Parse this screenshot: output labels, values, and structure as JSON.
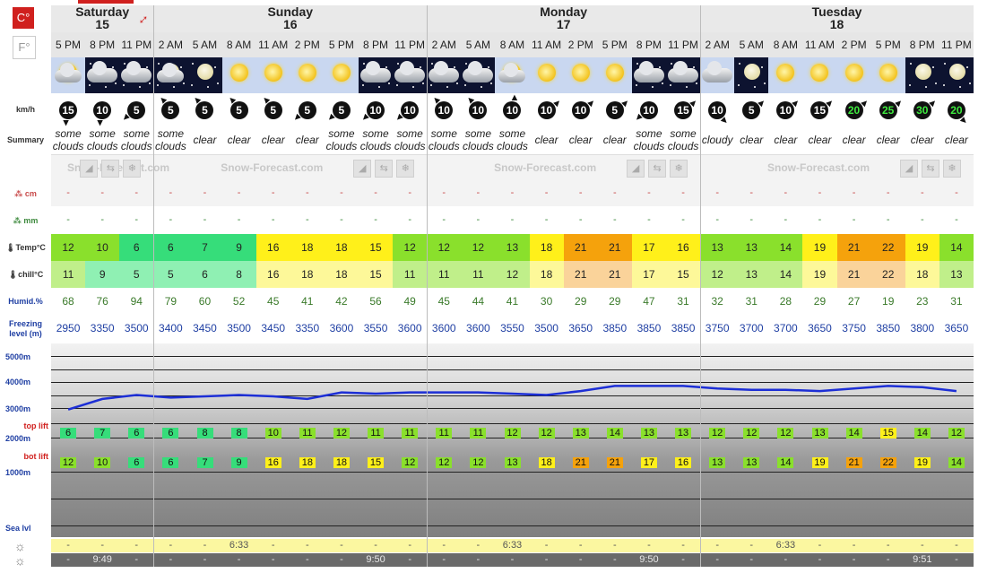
{
  "units": {
    "celsius": "C°",
    "fahrenheit": "F°"
  },
  "row_labels": {
    "wind": "km/h",
    "summary": "Summary",
    "snow": "cm",
    "rain": "mm",
    "temp": "Temp°C",
    "chill": "chill°C",
    "humid": "Humid.%",
    "freezing": "Freezing level (m)",
    "lift_top": "top lift",
    "lift_bot": "bot lift",
    "alt_5000": "5000m",
    "alt_4000": "4000m",
    "alt_3000": "3000m",
    "alt_2000": "2000m",
    "alt_1000": "1000m",
    "sea": "Sea lvl"
  },
  "days": [
    {
      "name": "Saturday",
      "date": "15",
      "cols": 3
    },
    {
      "name": "Sunday",
      "date": "16",
      "cols": 8
    },
    {
      "name": "Monday",
      "date": "17",
      "cols": 8
    },
    {
      "name": "Tuesday",
      "date": "18",
      "cols": 8
    }
  ],
  "logo_text": "Snow-Forecast.com",
  "hours": [
    "5 PM",
    "8 PM",
    "11 PM",
    "2 AM",
    "5 AM",
    "8 AM",
    "11 AM",
    "2 PM",
    "5 PM",
    "8 PM",
    "11 PM",
    "2 AM",
    "5 AM",
    "8 AM",
    "11 AM",
    "2 PM",
    "5 PM",
    "8 PM",
    "11 PM",
    "2 AM",
    "5 AM",
    "8 AM",
    "11 AM",
    "2 PM",
    "5 PM",
    "8 PM",
    "11 PM"
  ],
  "weather_icons": [
    "cloud-sun",
    "cloud-night",
    "cloud-night",
    "cloud-moon",
    "moon",
    "sun",
    "sun",
    "sun",
    "sun",
    "cloud-night",
    "cloud-night",
    "cloud-night",
    "cloud-night",
    "cloud-sun",
    "sun",
    "sun",
    "sun",
    "cloud-night",
    "cloud-night",
    "cloud",
    "moon",
    "sun",
    "sun",
    "sun",
    "sun",
    "moon",
    "moon"
  ],
  "wind_speed": [
    15,
    10,
    5,
    5,
    5,
    5,
    5,
    5,
    5,
    10,
    10,
    10,
    10,
    10,
    10,
    10,
    5,
    10,
    15,
    10,
    5,
    10,
    15,
    20,
    25,
    30,
    20
  ],
  "wind_arrow": [
    "down",
    "down",
    "down-left",
    "up-left",
    "up-left",
    "up-left",
    "up-left",
    "down-left",
    "down-left",
    "down-left",
    "down-left",
    "up-left",
    "up-left",
    "up",
    "up-right",
    "up-right",
    "up-right",
    "down-left",
    "up-right",
    "down-right",
    "up-right",
    "up-right",
    "up-right",
    "up-right",
    "up-right",
    "up-right",
    "down-right"
  ],
  "summary": [
    "some clouds",
    "some clouds",
    "some clouds",
    "some clouds",
    "clear",
    "clear",
    "clear",
    "clear",
    "some clouds",
    "some clouds",
    "some clouds",
    "some clouds",
    "some clouds",
    "some clouds",
    "clear",
    "clear",
    "clear",
    "some clouds",
    "some clouds",
    "cloudy",
    "clear",
    "clear",
    "clear",
    "clear",
    "clear",
    "clear",
    "clear"
  ],
  "snow": [
    "-",
    "-",
    "-",
    "-",
    "-",
    "-",
    "-",
    "-",
    "-",
    "-",
    "-",
    "-",
    "-",
    "-",
    "-",
    "-",
    "-",
    "-",
    "-",
    "-",
    "-",
    "-",
    "-",
    "-",
    "-",
    "-",
    "-"
  ],
  "rain": [
    "-",
    "-",
    "-",
    "-",
    "-",
    "-",
    "-",
    "-",
    "-",
    "-",
    "-",
    "-",
    "-",
    "-",
    "-",
    "-",
    "-",
    "-",
    "-",
    "-",
    "-",
    "-",
    "-",
    "-",
    "-",
    "-",
    "-"
  ],
  "temp": [
    12,
    10,
    6,
    6,
    7,
    9,
    16,
    18,
    18,
    15,
    12,
    12,
    12,
    13,
    18,
    21,
    21,
    17,
    16,
    13,
    13,
    14,
    19,
    21,
    22,
    19,
    14
  ],
  "chill": [
    11,
    9,
    5,
    5,
    6,
    8,
    16,
    18,
    18,
    15,
    11,
    11,
    11,
    12,
    18,
    21,
    21,
    17,
    15,
    12,
    13,
    14,
    19,
    21,
    22,
    18,
    13
  ],
  "humidity": [
    68,
    76,
    94,
    79,
    60,
    52,
    45,
    41,
    42,
    56,
    49,
    45,
    44,
    41,
    30,
    29,
    29,
    47,
    31,
    32,
    31,
    28,
    29,
    27,
    19,
    23,
    31
  ],
  "freezing": [
    2950,
    3350,
    3500,
    3400,
    3450,
    3500,
    3450,
    3350,
    3600,
    3550,
    3600,
    3600,
    3600,
    3550,
    3500,
    3650,
    3850,
    3850,
    3850,
    3750,
    3700,
    3700,
    3650,
    3750,
    3850,
    3800,
    3650
  ],
  "lift_top": [
    6,
    7,
    6,
    6,
    8,
    8,
    10,
    11,
    12,
    11,
    11,
    11,
    11,
    12,
    12,
    13,
    14,
    13,
    13,
    12,
    12,
    12,
    13,
    14,
    15,
    14,
    12
  ],
  "lift_bot": [
    12,
    10,
    6,
    6,
    7,
    9,
    16,
    18,
    18,
    15,
    12,
    12,
    12,
    13,
    18,
    21,
    21,
    17,
    16,
    13,
    13,
    14,
    19,
    21,
    22,
    19,
    14
  ],
  "sunrise": [
    "-",
    "-",
    "-",
    "-",
    "-",
    "6:33",
    "-",
    "-",
    "-",
    "-",
    "-",
    "-",
    "-",
    "6:33",
    "-",
    "-",
    "-",
    "-",
    "-",
    "-",
    "-",
    "6:33",
    "-",
    "-",
    "-",
    "-",
    "-"
  ],
  "sunset": [
    "-",
    "9:49",
    "-",
    "-",
    "-",
    "-",
    "-",
    "-",
    "-",
    "9:50",
    "-",
    "-",
    "-",
    "-",
    "-",
    "-",
    "-",
    "9:50",
    "-",
    "-",
    "-",
    "-",
    "-",
    "-",
    "-",
    "9:51",
    "-"
  ]
}
